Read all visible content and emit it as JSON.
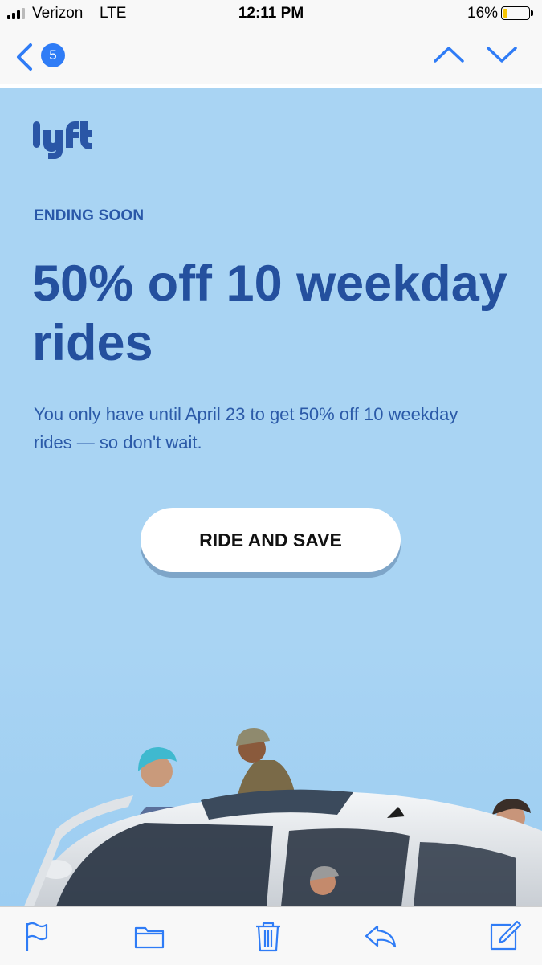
{
  "status_bar": {
    "carrier": "Verizon",
    "network": "LTE",
    "time": "12:11 PM",
    "battery": "16%",
    "battery_level": 0.16
  },
  "nav": {
    "back_count": "5",
    "icons": [
      "chevron-left-icon",
      "chevron-up-icon",
      "chevron-down-icon"
    ]
  },
  "email": {
    "logo_text": "lyft",
    "eyebrow": "ENDING SOON",
    "headline": "50% off 10 weekday rides",
    "body": "You only have until April 23 to get 50% off 10 weekday rides — so don't wait.",
    "cta_label": "RIDE AND SAVE"
  },
  "toolbar": {
    "icons": [
      "flag-icon",
      "folder-icon",
      "trash-icon",
      "reply-icon",
      "compose-icon"
    ]
  },
  "colors": {
    "accent": "#2f7cf6",
    "email_background": "#a9d4f3",
    "headline": "#24509e",
    "brand": "#2957a8"
  }
}
